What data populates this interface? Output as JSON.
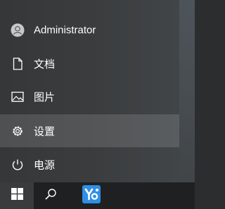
{
  "start_menu": {
    "items": [
      {
        "label": "Administrator",
        "icon": "user-avatar-icon"
      },
      {
        "label": "文档",
        "icon": "document-icon"
      },
      {
        "label": "图片",
        "icon": "pictures-icon"
      },
      {
        "label": "设置",
        "icon": "gear-icon"
      },
      {
        "label": "电源",
        "icon": "power-icon"
      }
    ],
    "highlighted_item": "设置"
  },
  "taskbar": {
    "start_icon": "windows-logo-icon",
    "search_icon": "search-icon",
    "pinned_app_icon": "app-icon"
  },
  "colors": {
    "accent_app": "#2f8fe6",
    "highlight": "#4b4d4f",
    "taskbar": "#1f2022"
  }
}
